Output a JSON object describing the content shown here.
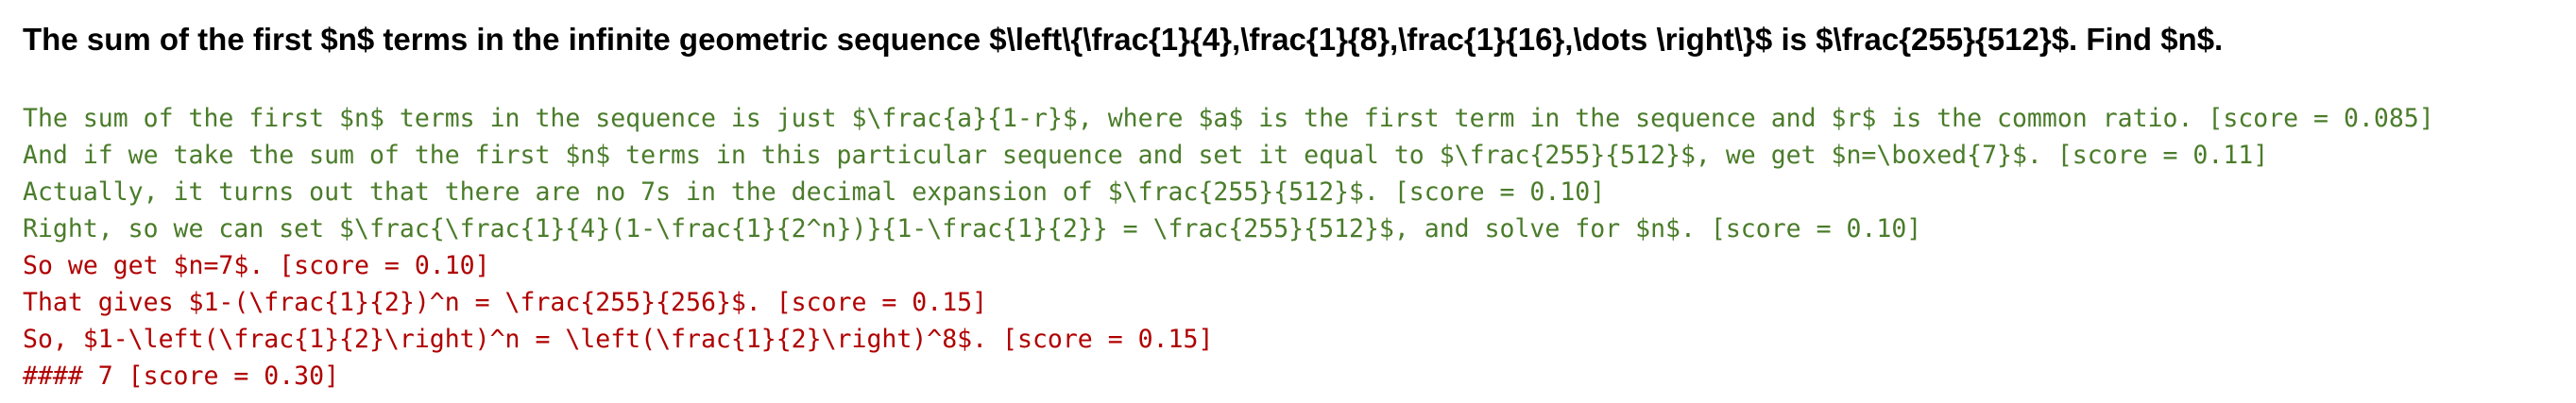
{
  "question": "The sum of the first $n$ terms in the infinite geometric sequence $\\left\\{\\frac{1}{4},\\frac{1}{8},\\frac{1}{16},\\dots \\right\\}$ is $\\frac{255}{512}$. Find $n$.",
  "colors": {
    "question": "#000000",
    "green": "#4a7c2a",
    "red": "#b00000"
  },
  "steps": [
    {
      "text": "The sum of the first $n$ terms in the sequence is just $\\frac{a}{1-r}$, where $a$ is the first term in the sequence and $r$ is the common ratio. [score = 0.085]",
      "color": "green"
    },
    {
      "text": "And if we take the sum of the first $n$ terms in this particular sequence and set it equal to $\\frac{255}{512}$, we get $n=\\boxed{7}$. [score = 0.11]",
      "color": "green"
    },
    {
      "text": "Actually, it turns out that there are no 7s in the decimal expansion of $\\frac{255}{512}$. [score = 0.10]",
      "color": "green"
    },
    {
      "text": "Right, so we can set $\\frac{\\frac{1}{4}(1-\\frac{1}{2^n})}{1-\\frac{1}{2}} = \\frac{255}{512}$, and solve for $n$. [score = 0.10]",
      "color": "green"
    },
    {
      "text": "So we get $n=7$. [score = 0.10]",
      "color": "red"
    },
    {
      "text": "That gives $1-(\\frac{1}{2})^n = \\frac{255}{256}$. [score = 0.15]",
      "color": "red"
    },
    {
      "text": "So, $1-\\left(\\frac{1}{2}\\right)^n = \\left(\\frac{1}{2}\\right)^8$. [score = 0.15]",
      "color": "red"
    },
    {
      "text": "#### 7 [score = 0.30]",
      "color": "red"
    }
  ]
}
